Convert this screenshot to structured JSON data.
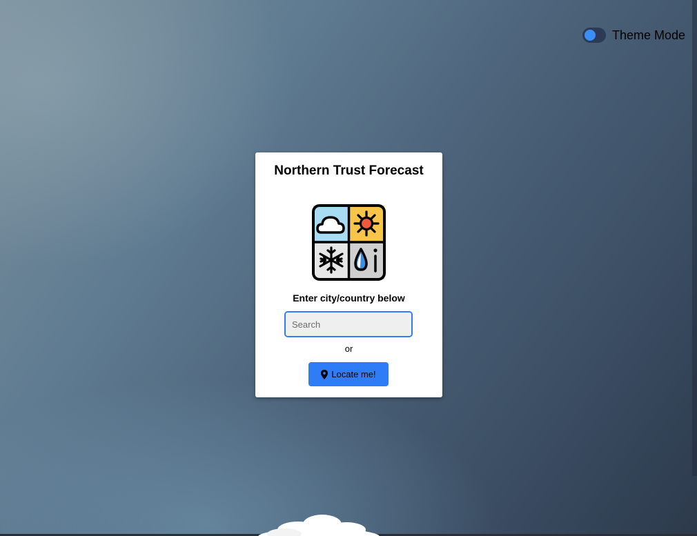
{
  "theme": {
    "label": "Theme Mode",
    "enabled": true,
    "knob_color": "#3a8ef5",
    "track_color": "#2d3a55"
  },
  "card": {
    "title": "Northern Trust Forecast",
    "logo_icon": "weather-grid-icon",
    "prompt": "Enter city/country below",
    "search": {
      "placeholder": "Search",
      "value": "",
      "button_icon": "search-icon"
    },
    "or_text": "or",
    "locate": {
      "label": "Locate me!",
      "icon": "map-pin-icon"
    }
  },
  "colors": {
    "accent": "#2f7df6",
    "card_background": "#ffffff"
  }
}
